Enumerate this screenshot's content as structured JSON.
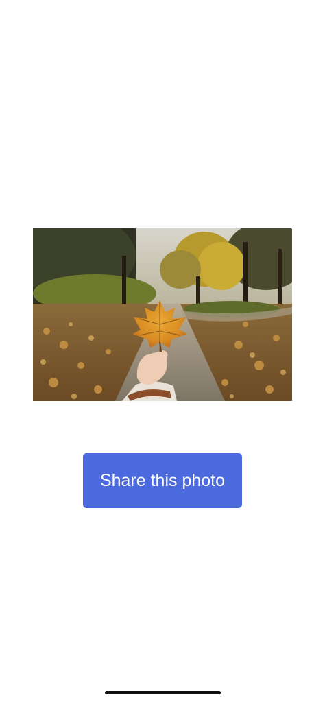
{
  "photo": {
    "subject": "hand holding an autumn maple leaf on a park path"
  },
  "share_button": {
    "label": "Share this photo",
    "color": "#4a6ade",
    "text_color": "#ffffff"
  },
  "home_indicator": {
    "color": "#111111"
  }
}
